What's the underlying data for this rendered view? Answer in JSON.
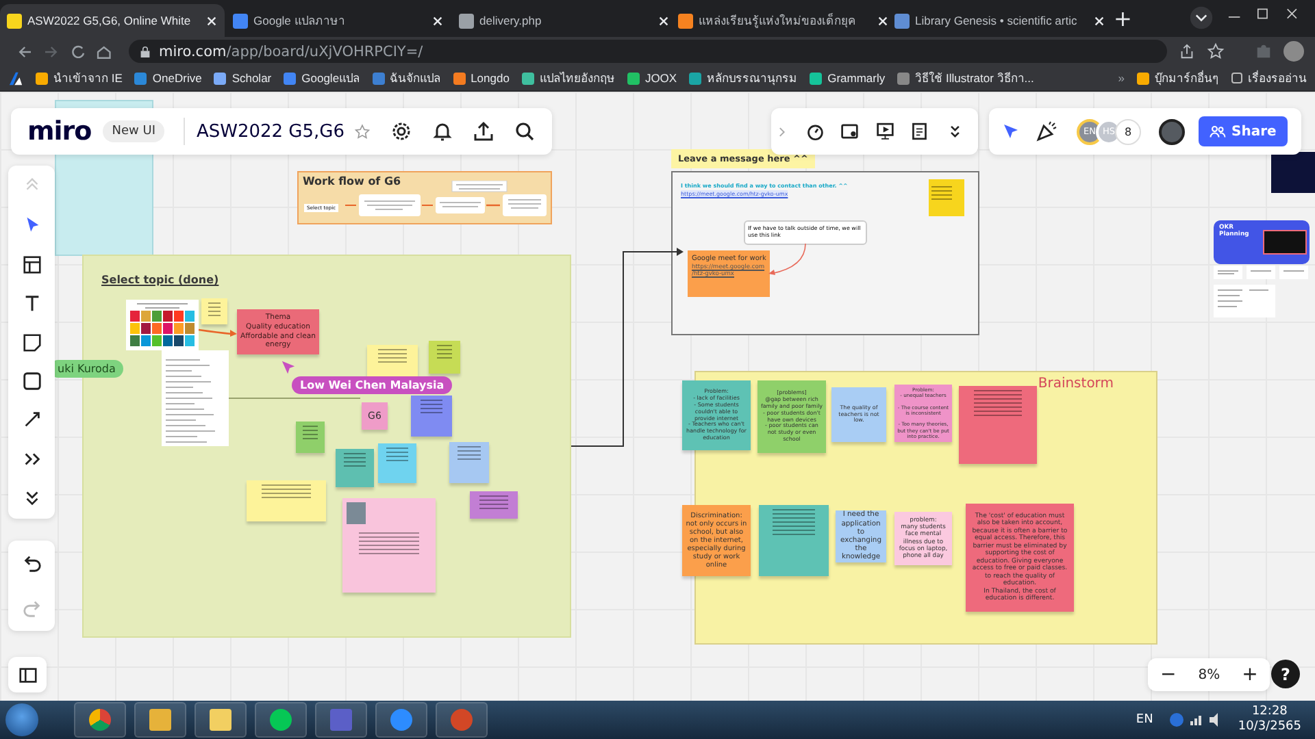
{
  "browser": {
    "tabs": [
      {
        "title": "ASW2022 G5,G6, Online White",
        "selected": true,
        "kind": "miro"
      },
      {
        "title": "Google แปลภาษา",
        "selected": false,
        "kind": "translate"
      },
      {
        "title": "delivery.php",
        "selected": false,
        "kind": "globe"
      },
      {
        "title": "แหล่งเรียนรู้แห่งใหม่ของเด็กยุค",
        "selected": false,
        "kind": "m"
      },
      {
        "title": "Library Genesis • scientific artic",
        "selected": false,
        "kind": "book"
      }
    ],
    "new_tab": "+",
    "url_host": "miro.com",
    "url_path": "/app/board/uXjVOHRPCIY=/",
    "bookmarks": [
      {
        "label": "นำเข้าจาก IE",
        "color": "#f9ab00"
      },
      {
        "label": "OneDrive",
        "color": "#2b88d8"
      },
      {
        "label": "Scholar",
        "color": "#7baaf7"
      },
      {
        "label": "Googleแปล",
        "color": "#4285f4"
      },
      {
        "label": "ฉันจักแปล",
        "color": "#3d7fd1"
      },
      {
        "label": "Longdo",
        "color": "#f47b20"
      },
      {
        "label": "แปลไทยอังกฤษ",
        "color": "#3fbf9f"
      },
      {
        "label": "JOOX",
        "color": "#21c064"
      },
      {
        "label": "หลักบรรณานุกรม",
        "color": "#1aa5a5"
      },
      {
        "label": "Grammarly",
        "color": "#15c39a"
      },
      {
        "label": "วิธีใช้ Illustrator วิธีกา...",
        "color": "#888888"
      }
    ],
    "more": "»",
    "other_bookmarks": "บุ๊กมาร์กอื่นๆ",
    "reading_list": "เรื่องรออ่าน"
  },
  "miro": {
    "logo": "miro",
    "badge": "New UI",
    "board_title": "ASW2022 G5,G6",
    "collaborators": [
      {
        "initials": "EN",
        "color": "#8a8f99"
      },
      {
        "initials": "HS",
        "color": "#c3c7cf"
      }
    ],
    "collaborator_count": "8",
    "share": "Share",
    "zoom_out": "−",
    "zoom": "8%",
    "zoom_in": "+",
    "help": "?"
  },
  "workflow": {
    "title": "Work flow of G6",
    "first_step": "Select topic"
  },
  "topic_frame": {
    "title": "Select topic (done)",
    "theme_sticky": "Thema\nQuality education\nAffordable and clean energy",
    "group_sticky": "G6",
    "stickies": [
      {
        "color": "#fdf39a"
      },
      {
        "color": "#fdf39a"
      },
      {
        "color": "#c6dc55"
      },
      {
        "color": "#8fcf6a"
      },
      {
        "color": "#5ebfb0"
      },
      {
        "color": "#6fd3ef"
      },
      {
        "color": "#7f8bf2"
      },
      {
        "color": "#a6c8f2"
      },
      {
        "color": "#c27ed4"
      },
      {
        "color": "#fdf39a"
      },
      {
        "color": "#f9c4dc"
      }
    ]
  },
  "cursors": [
    {
      "name": "uki Kuroda",
      "color": "#7ed37f"
    },
    {
      "name": "Low Wei Chen Malaysia",
      "color": "#c850c0"
    }
  ],
  "message_frame": {
    "title": "Leave a message here ^^",
    "note": "I think we should find a way to contact than other. ^^",
    "note_link": "https://meet.google.com/htz-gvko-umx",
    "comment": "If we have to talk outside of time, we will use this link",
    "meet_title": "Google meet for work",
    "meet_link": "https://meet.google.com/htz-gvko-umx"
  },
  "template_card": {
    "title": "OKR Planning"
  },
  "brainstorm": {
    "title": "Brainstorm",
    "stickies": [
      {
        "kind": "text",
        "color": "#5ec2b4",
        "text": "Problem:\n- lack of facilities\n- Some students couldn't able to provide internet\n- Teachers who can't handle technology for education"
      },
      {
        "kind": "text",
        "color": "#8fd06a",
        "text": "[problems]\n@gap between rich family and poor family\n- poor students don't have own devices\n- poor students can not study or even school"
      },
      {
        "kind": "text",
        "color": "#a9cdf4",
        "text": "The quality of teachers is not low."
      },
      {
        "kind": "text",
        "color": "#ef93c8",
        "text": "Problem:\n- unequal teachers\n\n- The course content is inconsistent\n\n- Too many theories, but they can't be put into practice."
      },
      {
        "kind": "lines",
        "color": "#ee6a7c"
      },
      {
        "kind": "text",
        "color": "#fb9f4b",
        "text": "Discrimination: not only occurs in school, but also on the internet, especially during study or work online"
      },
      {
        "kind": "lines",
        "color": "#5ec2b4"
      },
      {
        "kind": "text",
        "color": "#a9cdf4",
        "text": "I need the application to exchanging the knowledge"
      },
      {
        "kind": "text",
        "color": "#fbc9df",
        "text": "problem:\nmany students face mental illness due to focus on laptop, phone all day"
      },
      {
        "kind": "text",
        "color": "#ee6a7c",
        "text": "The 'cost' of education must also be taken into account, because it is often a barrier to equal access. Therefore, this barrier must be eliminated by supporting the cost of education. Giving everyone access to free or paid classes. to reach the quality of education.\nIn Thailand, the cost of education is different."
      }
    ]
  },
  "taskbar": {
    "language": "EN",
    "time": "12:28",
    "date": "10/3/2565"
  }
}
